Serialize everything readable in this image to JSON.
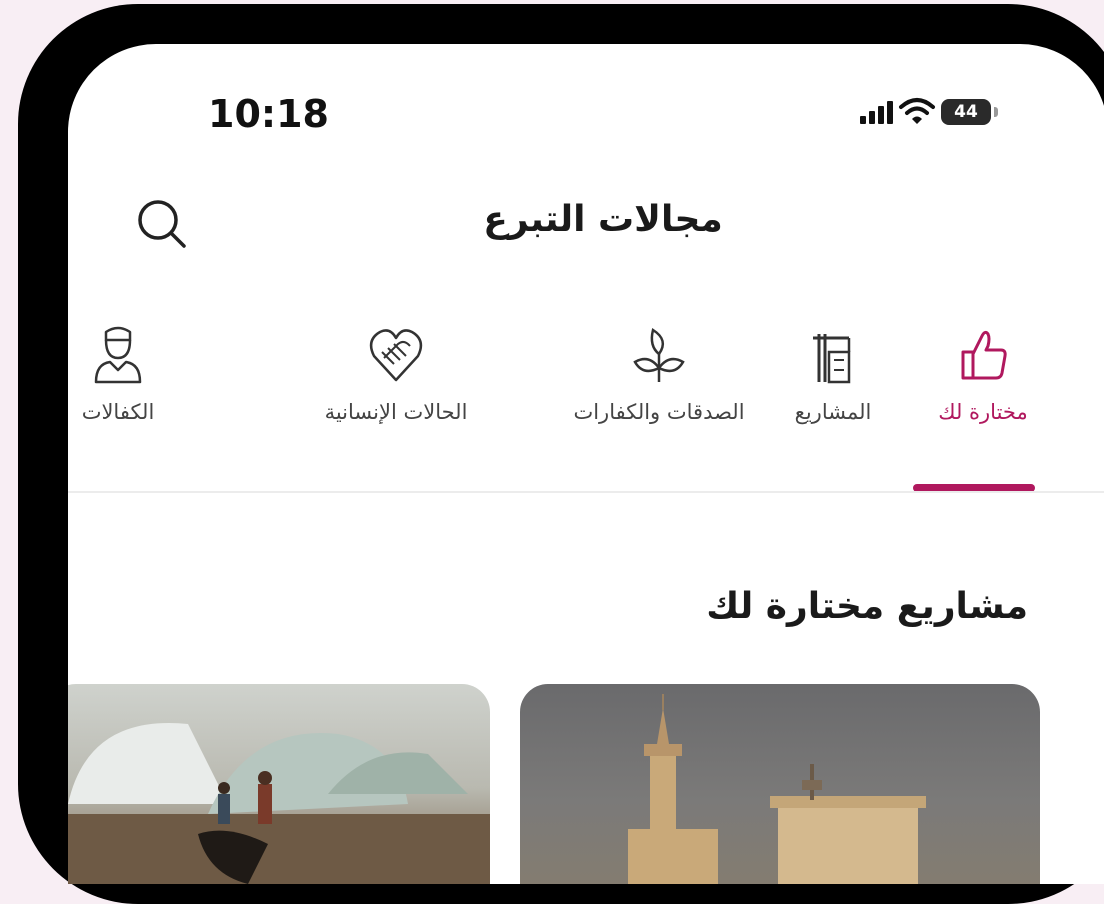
{
  "status_bar": {
    "time": "10:18",
    "battery": "44"
  },
  "header": {
    "title": "مجالات التبرع"
  },
  "tabs": [
    {
      "label": "مختارة لك",
      "icon": "thumbs-up-icon",
      "active": true
    },
    {
      "label": "المشاريع",
      "icon": "construction-crane-icon",
      "active": false
    },
    {
      "label": "الصدقات والكفارات",
      "icon": "sprout-icon",
      "active": false
    },
    {
      "label": "الحالات الإنسانية",
      "icon": "handshake-heart-icon",
      "active": false
    },
    {
      "label": "الكفالات",
      "icon": "person-icon",
      "active": false
    }
  ],
  "section": {
    "title": "مشاريع مختارة لك"
  },
  "cards": [
    {
      "image": "mosque-image"
    },
    {
      "image": "refugee-tents-image"
    }
  ],
  "colors": {
    "accent": "#b0185e",
    "text": "#1a1a1a"
  }
}
